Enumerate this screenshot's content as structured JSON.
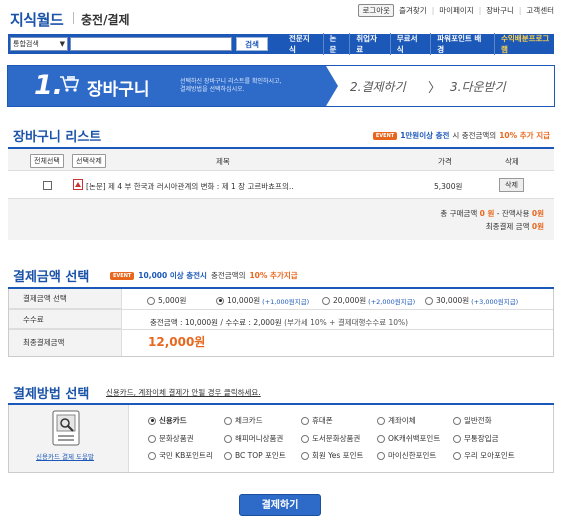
{
  "header": {
    "logo": "지식월드",
    "subtitle": "충전/결제",
    "login": "로그아웃",
    "links": [
      "즐겨찾기",
      "마이페이지",
      "장바구니",
      "고객센터"
    ]
  },
  "nav": {
    "search_select": "통합검색",
    "search_value": "",
    "search_button": "검색",
    "menu": [
      "전문지식",
      "논문",
      "취업자료",
      "무료서식",
      "파워포인트 배경",
      "수익배분프로그램"
    ]
  },
  "steps": {
    "step1_num": "1.",
    "step1_title": "장바구니",
    "step1_desc_1": "선택하신 장바구니 리스트를 확인하시고,",
    "step1_desc_2": "결제방법을 선택하십시오.",
    "step2": "2.결제하기",
    "separator": "〉",
    "step3": "3.다운받기"
  },
  "cart": {
    "title": "장바구니 리스트",
    "event_badge": "EVENT",
    "event_blue": "1만원이상 충전",
    "event_mid": "시 충전금액의",
    "event_red": "10% 추가 지급",
    "btn_select_all": "전체선택",
    "btn_delete_selected": "선택삭제",
    "col_title": "제목",
    "col_price": "가격",
    "col_delete": "삭제",
    "items": [
      {
        "title": "[논문] 제 4 부 한국과 러시아관계의 변화 : 제 1 장 고르바쵸프의..",
        "price": "5,300원",
        "delete": "삭제"
      }
    ],
    "sum_label": "총 구매금액",
    "sum_value": "0 원",
    "sum_sep": "- 잔액사용",
    "balance_value": "0원",
    "final_label": "최종결제 금액",
    "final_value": "0원"
  },
  "amount": {
    "title": "결제금액 선택",
    "event_badge": "EVENT",
    "event_blue": "10,000 이상 충전시",
    "event_mid": "충전금액의",
    "event_red": "10% 추가지급",
    "row_select": "결제금액 선택",
    "options": [
      {
        "label": "5,000원",
        "bonus": "",
        "selected": false
      },
      {
        "label": "10,000원",
        "bonus": "(+1,000원지급)",
        "selected": true
      },
      {
        "label": "20,000원",
        "bonus": "(+2,000원지급)",
        "selected": false
      },
      {
        "label": "30,000원",
        "bonus": "(+3,000원지급)",
        "selected": false
      }
    ],
    "row_fee": "수수료",
    "fee_text": "충전금액 : 10,000원  /  수수료 : 2,000원",
    "fee_note": "(부가세 10% + 결제대행수수료 10%)",
    "row_final": "최종결제금액",
    "final_amount": "12,000원"
  },
  "method": {
    "title": "결제방법 선택",
    "note": "신용카드, 계좌이체 결제가 안될 경우 클릭하세요.",
    "help": "신용카드 결제 도움말",
    "options": [
      [
        "신용카드",
        "체크카드",
        "휴대폰",
        "계좌이체",
        "일반전화"
      ],
      [
        "문화상품권",
        "해피머니상품권",
        "도서문화상품권",
        "OK캐쉬백포인트",
        "무통장입금"
      ],
      [
        "국민 KB포인트리",
        "BC TOP 포인트",
        "회원 Yes 포인트",
        "마이신한포인트",
        "우리 모아포인트"
      ]
    ],
    "selected": "신용카드"
  },
  "pay_button": "결제하기",
  "colors": {
    "primary": "#1c58b8",
    "accent": "#e8671e"
  }
}
